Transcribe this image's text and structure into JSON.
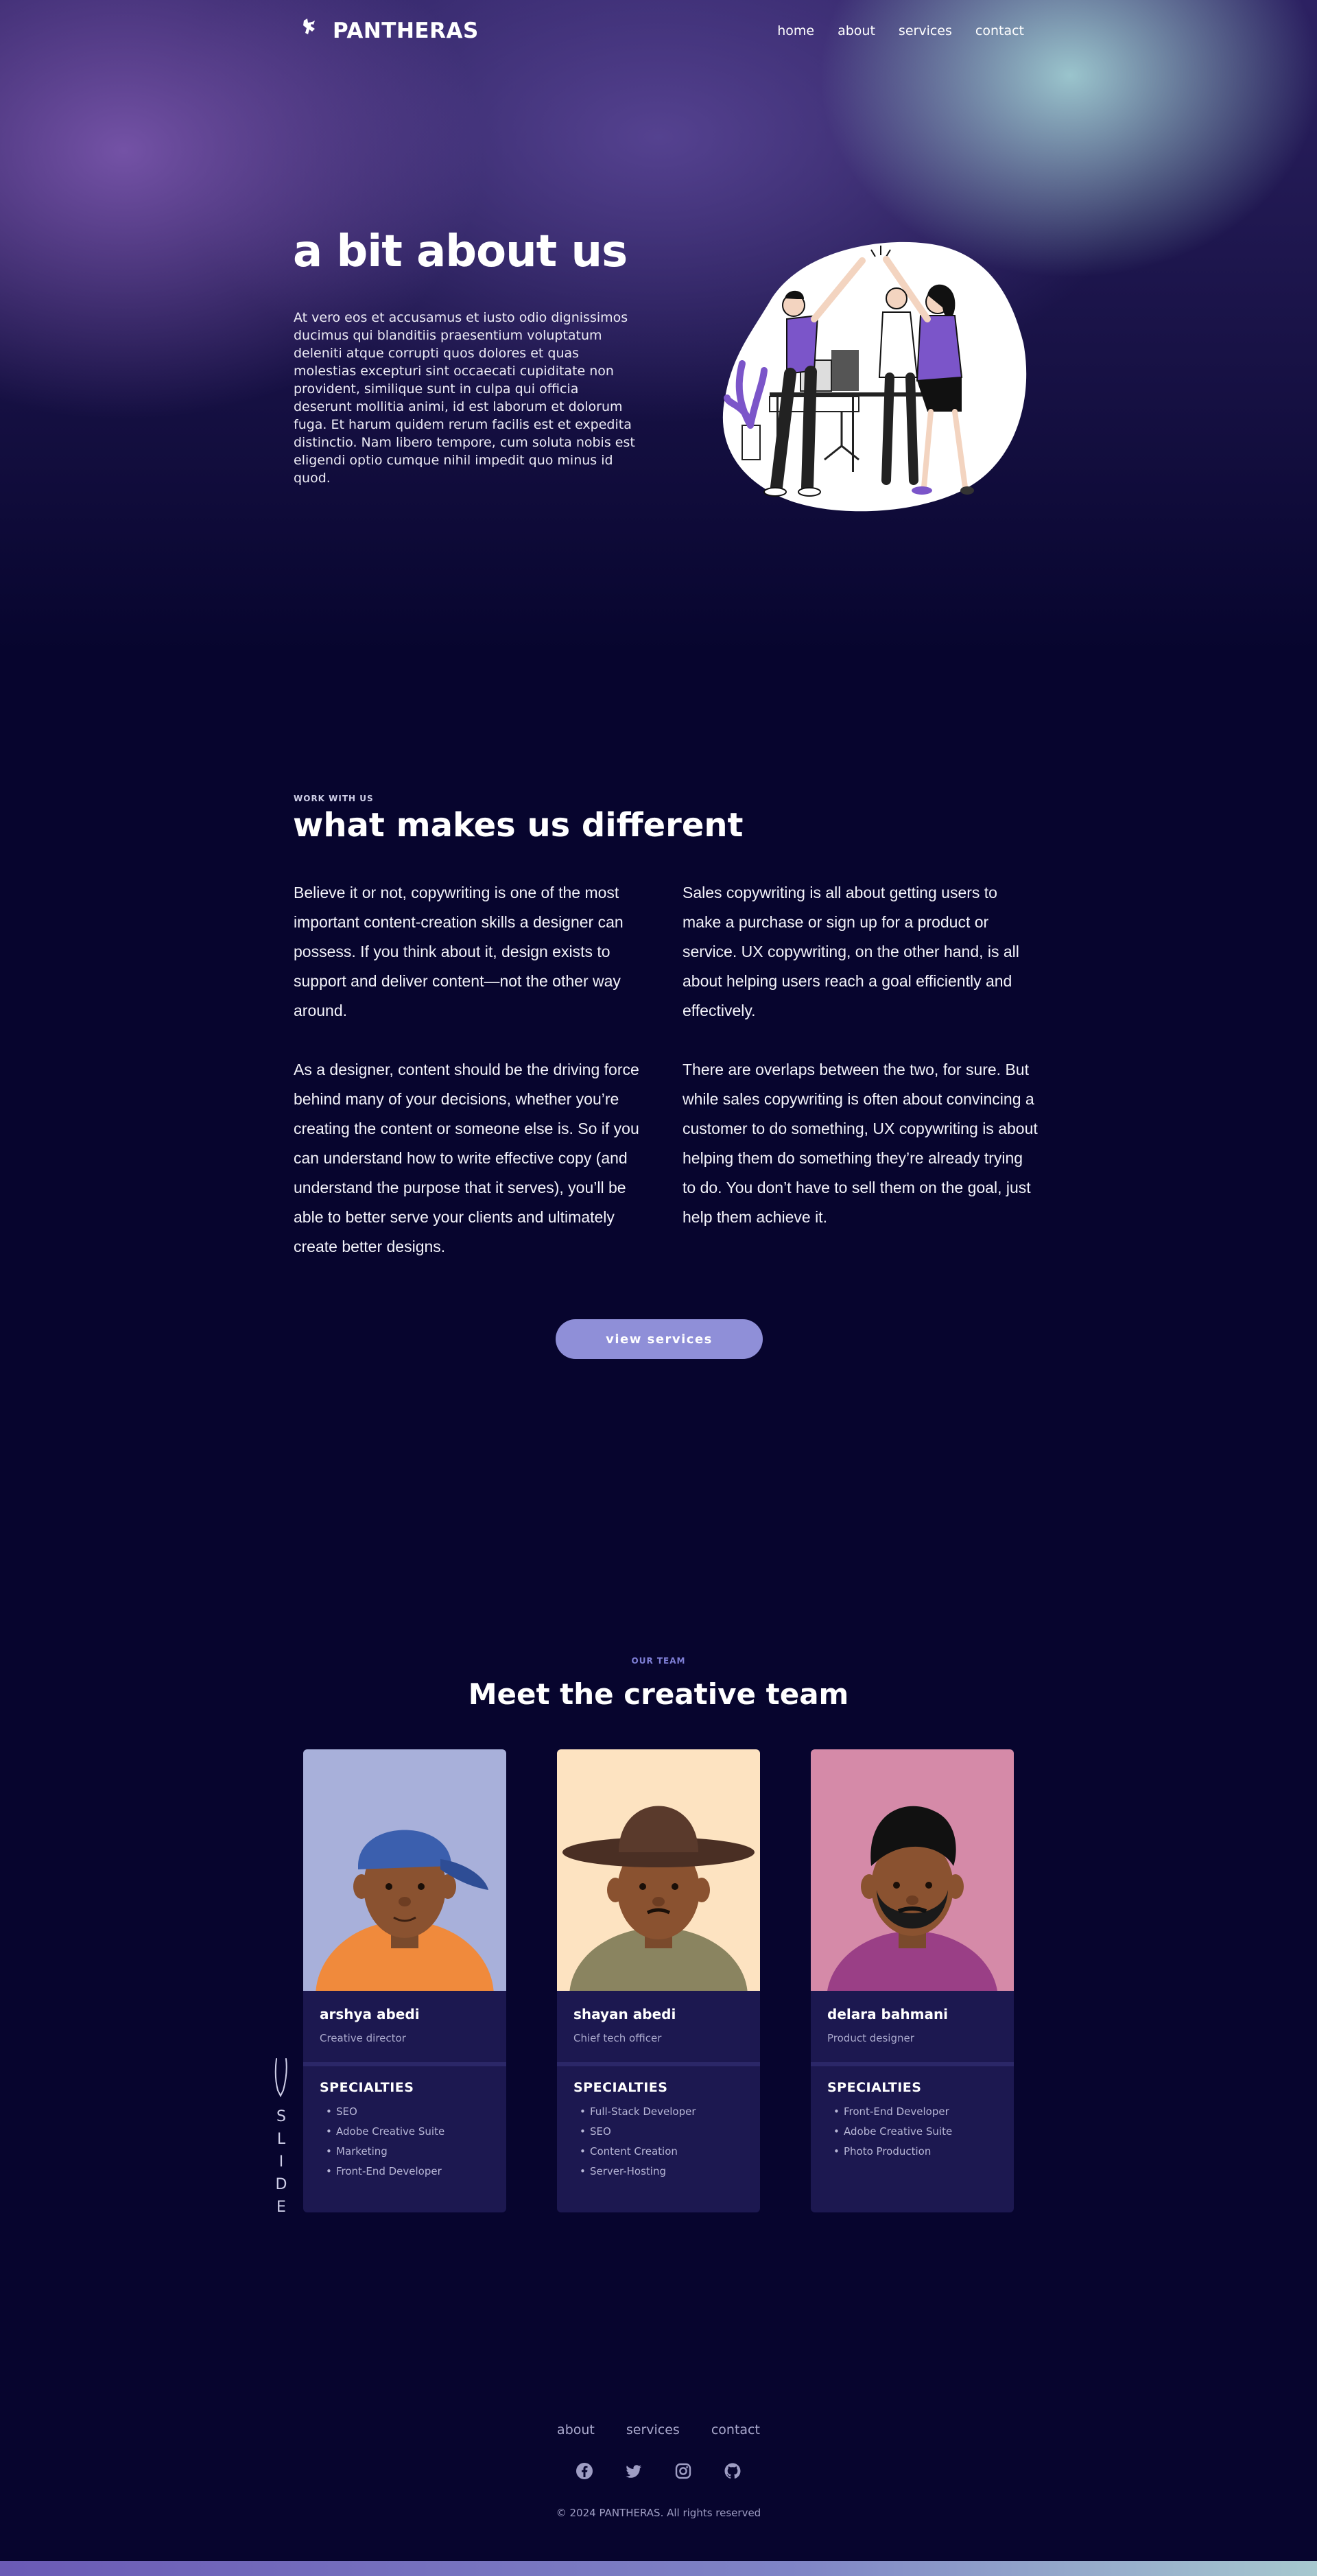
{
  "brand": {
    "name": "PANTHERAS"
  },
  "nav": {
    "items": [
      "home",
      "about",
      "services",
      "contact"
    ]
  },
  "about": {
    "title": "a bit about us",
    "text": "At vero eos et accusamus et iusto odio dignissimos ducimus qui blanditiis praesentium voluptatum deleniti atque corrupti quos dolores et quas molestias excepturi sint occaecati cupiditate non provident, similique sunt in culpa qui officia deserunt mollitia animi, id est laborum et dolorum fuga. Et harum quidem rerum facilis est et expedita distinctio. Nam libero tempore, cum soluta nobis est eligendi optio cumque nihil impedit quo minus id quod."
  },
  "different": {
    "eyebrow": "WORK WITH US",
    "title": "what makes us different",
    "left": [
      "Believe it or not, copywriting is one of the most important content-creation skills a designer can possess. If you think about it, design exists to support and deliver content—not the other way around.",
      "As a designer, content should be the driving force behind many of your decisions, whether you’re creating the content or someone else is. So if you can understand how to write effective copy (and understand the purpose that it serves), you’ll be able to better serve your clients and ultimately create better designs."
    ],
    "right": [
      "Sales copywriting is all about getting users to make a purchase or sign up for a product or service. UX copywriting, on the other hand, is all about helping users reach a goal efficiently and effectively.",
      "There are overlaps between the two, for sure. But while sales copywriting is often about convincing a customer to do something, UX copywriting is about helping them do something they’re already trying to do. You don’t have to sell them on the goal, just help them achieve it."
    ],
    "button": "view services"
  },
  "team": {
    "eyebrow": "OUR TEAM",
    "title": "Meet the creative team",
    "specialties_label": "SPECIALTIES",
    "members": [
      {
        "name": "arshya abedi",
        "role": "Creative director",
        "bg": "#a8b0da",
        "specialties": [
          "SEO",
          "Adobe Creative Suite",
          "Marketing",
          "Front-End Developer"
        ]
      },
      {
        "name": "shayan abedi",
        "role": "Chief tech officer",
        "bg": "#fde3c1",
        "specialties": [
          "Full-Stack Developer",
          "SEO",
          "Content Creation",
          "Server-Hosting"
        ]
      },
      {
        "name": "delara bahmani",
        "role": "Product designer",
        "bg": "#d58aa8",
        "specialties": [
          "Front-End Developer",
          "Adobe Creative Suite",
          "Photo Production"
        ]
      }
    ],
    "slide_label": "SLIDE"
  },
  "footer": {
    "links": [
      "about",
      "services",
      "contact"
    ],
    "socials": [
      "facebook-icon",
      "twitter-icon",
      "instagram-icon",
      "github-icon"
    ],
    "copyright": "© 2024 PANTHERAS. All rights reserved"
  },
  "colors": {
    "background": "#07052e",
    "accent": "#8f8fd8",
    "card": "#1c1850"
  }
}
